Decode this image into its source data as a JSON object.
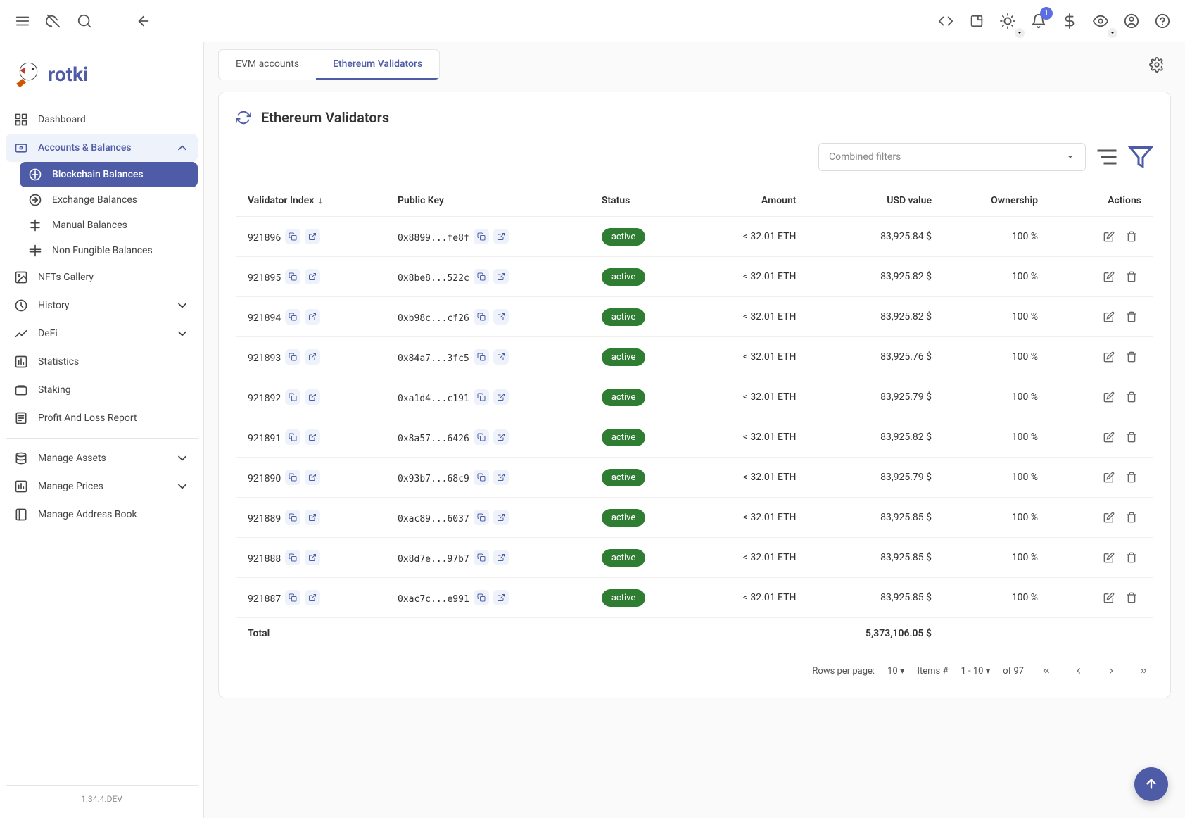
{
  "topbar": {
    "notification_count": "1"
  },
  "brand": {
    "name": "rotki"
  },
  "nav": {
    "dashboard": "Dashboard",
    "accounts": "Accounts & Balances",
    "blockchain": "Blockchain Balances",
    "exchange": "Exchange Balances",
    "manual": "Manual Balances",
    "nfb": "Non Fungible Balances",
    "nfts": "NFTs Gallery",
    "history": "History",
    "defi": "DeFi",
    "statistics": "Statistics",
    "staking": "Staking",
    "pnl": "Profit And Loss Report",
    "assets": "Manage Assets",
    "prices": "Manage Prices",
    "addrbook": "Manage Address Book"
  },
  "version": "1.34.4.DEV",
  "tabs": {
    "evm": "EVM accounts",
    "eth": "Ethereum Validators"
  },
  "panel": {
    "title": "Ethereum Validators"
  },
  "filter": {
    "placeholder": "Combined filters"
  },
  "columns": {
    "index": "Validator Index",
    "pubkey": "Public Key",
    "status": "Status",
    "amount": "Amount",
    "usd": "USD value",
    "ownership": "Ownership",
    "actions": "Actions"
  },
  "rows": [
    {
      "index": "921896",
      "pubkey": "0x8899...fe8f",
      "status": "active",
      "amount": "< 32.01 ETH",
      "usd": "83,925.84 $",
      "ownership": "100 %"
    },
    {
      "index": "921895",
      "pubkey": "0x8be8...522c",
      "status": "active",
      "amount": "< 32.01 ETH",
      "usd": "83,925.82 $",
      "ownership": "100 %"
    },
    {
      "index": "921894",
      "pubkey": "0xb98c...cf26",
      "status": "active",
      "amount": "< 32.01 ETH",
      "usd": "83,925.82 $",
      "ownership": "100 %"
    },
    {
      "index": "921893",
      "pubkey": "0x84a7...3fc5",
      "status": "active",
      "amount": "< 32.01 ETH",
      "usd": "83,925.76 $",
      "ownership": "100 %"
    },
    {
      "index": "921892",
      "pubkey": "0xa1d4...c191",
      "status": "active",
      "amount": "< 32.01 ETH",
      "usd": "83,925.79 $",
      "ownership": "100 %"
    },
    {
      "index": "921891",
      "pubkey": "0x8a57...6426",
      "status": "active",
      "amount": "< 32.01 ETH",
      "usd": "83,925.82 $",
      "ownership": "100 %"
    },
    {
      "index": "921890",
      "pubkey": "0x93b7...68c9",
      "status": "active",
      "amount": "< 32.01 ETH",
      "usd": "83,925.79 $",
      "ownership": "100 %"
    },
    {
      "index": "921889",
      "pubkey": "0xac89...6037",
      "status": "active",
      "amount": "< 32.01 ETH",
      "usd": "83,925.85 $",
      "ownership": "100 %"
    },
    {
      "index": "921888",
      "pubkey": "0x8d7e...97b7",
      "status": "active",
      "amount": "< 32.01 ETH",
      "usd": "83,925.85 $",
      "ownership": "100 %"
    },
    {
      "index": "921887",
      "pubkey": "0xac7c...e991",
      "status": "active",
      "amount": "< 32.01 ETH",
      "usd": "83,925.85 $",
      "ownership": "100 %"
    }
  ],
  "total": {
    "label": "Total",
    "usd": "5,373,106.05 $"
  },
  "pagination": {
    "rows_label": "Rows per page:",
    "rows_value": "10",
    "items_label": "Items #",
    "items_value": "1 - 10",
    "of_text": "of 97"
  }
}
